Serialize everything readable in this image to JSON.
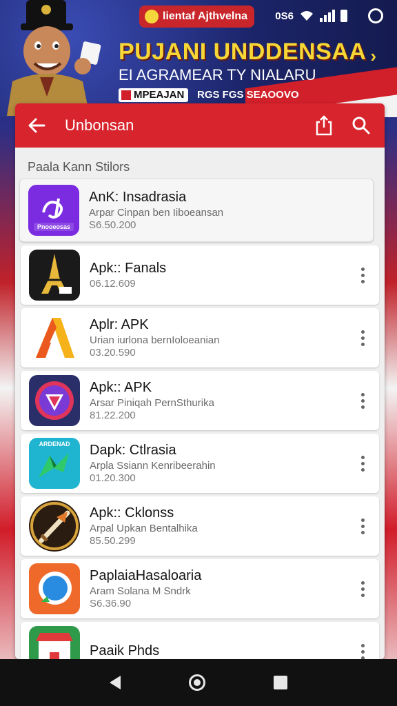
{
  "status_bar": {
    "notification_text": "lientaf Ajthvelna",
    "carrier_text": "0S6"
  },
  "promo": {
    "title": "PUJANI UNDDENSAA",
    "subtitle": "EI AGRAMEAR TY NIALARU",
    "tag": "MPEAJAN",
    "tag_secondary": "RGS FGS SEAOOVO"
  },
  "toolbar": {
    "title": "Unbonsan"
  },
  "section": {
    "label": "Paala Kann Stilors"
  },
  "apps": [
    {
      "name": "AnK: Insadrasia",
      "desc": "Arpar Cinpan ben Iiboeansan",
      "size": "S6.50.200",
      "icon_label": "Pnooeosas",
      "icon_color": "#7b2be0"
    },
    {
      "name": "Apk:: Fanals",
      "desc": "",
      "size": "06.12.609",
      "icon_color": "#1a1a1a"
    },
    {
      "name": "Aplr: APK",
      "desc": "Urian iurlona bernIoloeanian",
      "size": "03.20.590",
      "icon_color": "#ffffff"
    },
    {
      "name": "Apk:: APK",
      "desc": "Arsar Piniqah PernSthurika",
      "size": "81.22.200",
      "icon_color": "#2a2f6a"
    },
    {
      "name": "Dapk: Ctlrasia",
      "desc": "Arpla Ssiann Kenribeerahin",
      "size": "01.20.300",
      "icon_label": "ARDENAD",
      "icon_color": "#1fb5d0"
    },
    {
      "name": "Apk:: Cklonss",
      "desc": "Arpal Upkan Bentalhika",
      "size": "85.50.299",
      "icon_color": "#2a1c10"
    },
    {
      "name": "PaplaiaHasaloaria",
      "desc": "Aram Solana M Sndrk",
      "size": "S6.36.90",
      "icon_color": "#ef6a2a"
    },
    {
      "name": "Paaik Phds",
      "desc": "",
      "size": "",
      "icon_color": "#2e9a4a"
    }
  ],
  "colors": {
    "brand_red": "#d8242d",
    "promo_yellow": "#f6d735",
    "banner_blue": "#1b2468"
  },
  "icons": [
    "back-arrow-icon",
    "share-icon",
    "search-icon",
    "more-vert-icon",
    "nav-back-icon",
    "nav-home-icon",
    "nav-recents-icon"
  ]
}
